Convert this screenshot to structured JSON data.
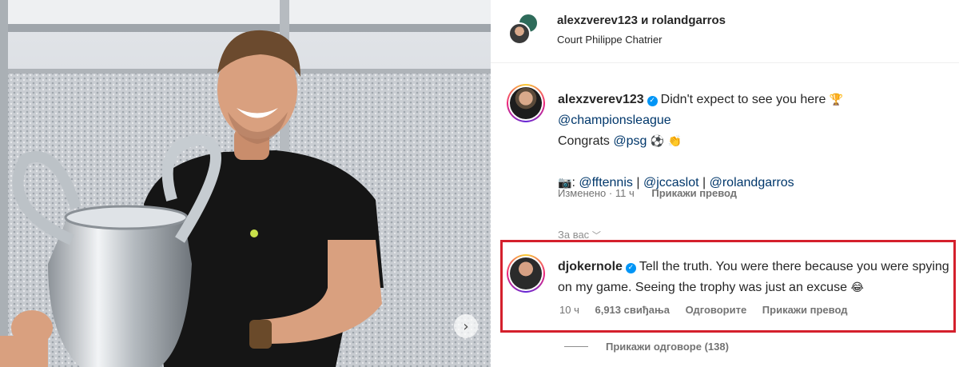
{
  "post": {
    "header": {
      "users": "alexzverev123 и rolandgarros",
      "location": "Court Philippe Chatrier"
    },
    "caption": {
      "username": "alexzverev123",
      "line1": "Didn't expect to see you here",
      "line1_emoji": "🏆",
      "mention_champions": "@championsleague",
      "congrats": "Congrats",
      "mention_psg": "@psg",
      "emoji_ball": "⚽",
      "emoji_clap": "👏",
      "camera_emoji": "📷",
      "credit_separator_1": ":",
      "credit_1": "@fftennis",
      "credit_sep": "|",
      "credit_2": "@jccaslot",
      "credit_3": "@rolandgarros",
      "edited": "Изменено · 11 ч",
      "translate": "Прикажи превод"
    },
    "for_you_label": "За вас",
    "comment": {
      "username": "djokernole",
      "text": "Tell the truth. You were there because you were spying on my game. Seeing the trophy was just an excuse",
      "emoji": "😂",
      "time": "10 ч",
      "likes": "6,913 свиђања",
      "reply": "Одговорите",
      "translate": "Прикажи превод"
    },
    "view_replies": "Прикажи одговоре (138)",
    "carousel_next_icon": "chevron-right-icon"
  },
  "colors": {
    "highlight_border": "#d4202c",
    "verified_blue": "#0095f6",
    "mention_color": "#00376b",
    "meta_gray": "#737373"
  }
}
